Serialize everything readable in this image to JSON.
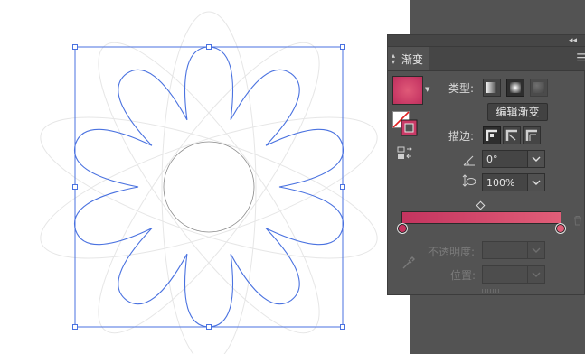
{
  "panel": {
    "tab_label": "渐变",
    "collapse_glyph": "◂◂",
    "menu_glyph": "☰"
  },
  "gradient": {
    "type_label": "类型",
    "type_colon": ":",
    "types": [
      "linear",
      "radial",
      "freeform"
    ],
    "selected_type": "radial",
    "edit_button_label": "编辑渐变",
    "stroke_label": "描边",
    "stroke_colon": ":",
    "angle_value": "0°",
    "aspect_value": "100%",
    "opacity_label": "不透明度",
    "opacity_colon": ":",
    "location_label": "位置",
    "location_colon": ":",
    "stops": [
      {
        "color": "#c4345f",
        "location": 0
      },
      {
        "color": "#e15e78",
        "location": 1
      }
    ],
    "midpoint": 0.5
  },
  "colors": {
    "selection_blue": "#4a72e0",
    "panel_bg": "#535353",
    "gradient_start": "#c4345f",
    "gradient_end": "#e15e78"
  },
  "icons": [
    "collapse-icon",
    "panel-menu-icon",
    "fill-stroke-icon",
    "swap-icon",
    "angle-icon",
    "aspect-ratio-icon",
    "trash-icon",
    "eyedropper-icon"
  ]
}
